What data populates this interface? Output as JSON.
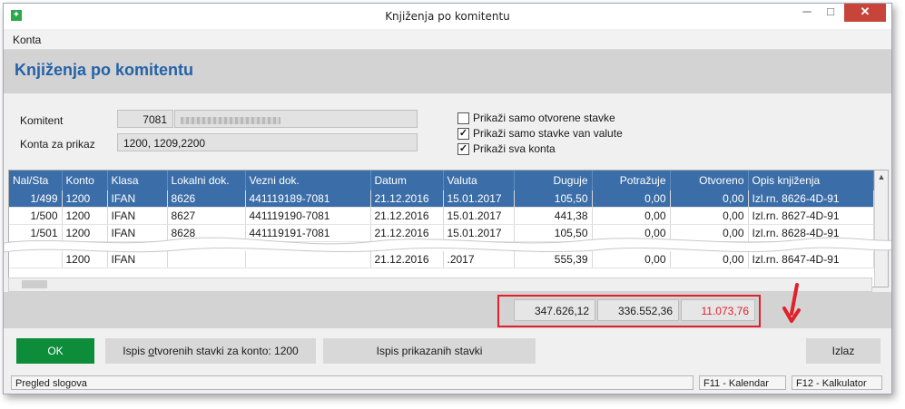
{
  "window": {
    "title": "Knjiženja po komitentu",
    "min_glyph": "─",
    "max_glyph": "□",
    "close_glyph": "✕"
  },
  "menu": {
    "items": [
      "Konta"
    ]
  },
  "header": {
    "title": "Knjiženja po komitentu"
  },
  "filters": {
    "komitent_label": "Komitent",
    "komitent_code": "7081",
    "konta_label": "Konta za prikaz",
    "konta_value": "1200, 1209,2200",
    "checkboxes": [
      {
        "label": "Prikaži samo otvorene stavke",
        "checked": false
      },
      {
        "label": "Prikaži samo stavke van valute",
        "checked": true
      },
      {
        "label": "Prikaži sva konta",
        "checked": true
      }
    ]
  },
  "table": {
    "columns": [
      "Nal/Sta",
      "Konto",
      "Klasa",
      "Lokalni dok.",
      "Vezni dok.",
      "Datum",
      "Valuta",
      "Duguje",
      "Potražuje",
      "Otvoreno",
      "Opis knjiženja"
    ],
    "rows": [
      [
        "1/499",
        "1200",
        "IFAN",
        "8626",
        "441119189-7081",
        "21.12.2016",
        "15.01.2017",
        "105,50",
        "0,00",
        "0,00",
        "Izl.rn. 8626-4D-91"
      ],
      [
        "1/500",
        "1200",
        "IFAN",
        "8627",
        "441119190-7081",
        "21.12.2016",
        "15.01.2017",
        "441,38",
        "0,00",
        "0,00",
        "Izl.rn. 8627-4D-91"
      ],
      [
        "1/501",
        "1200",
        "IFAN",
        "8628",
        "441119191-7081",
        "21.12.2016",
        "15.01.2017",
        "105,50",
        "0,00",
        "0,00",
        "Izl.rn. 8628-4D-91"
      ],
      [
        "",
        "1200",
        "IFAN",
        "",
        "",
        "21.12.2016",
        ".2017",
        "555,39",
        "0,00",
        "0,00",
        "Izl.rn. 8647-4D-91"
      ]
    ]
  },
  "totals": {
    "duguje": "347.626,12",
    "potrazuje": "336.552,36",
    "otvoreno": "11.073,76"
  },
  "buttons": {
    "ok": "OK",
    "ispis_otvorenih_prefix": "Ispis ",
    "ispis_otvorenih_hot": "o",
    "ispis_otvorenih_suffix": "tvorenih stavki za konto: 1200",
    "ispis_prikazanih": "Ispis prikazanih stavki",
    "izlaz": "Izlaz"
  },
  "status": {
    "left": "Pregled slogova",
    "f11": "F11 - Kalendar",
    "f12": "F12 - Kalkulator"
  },
  "colors": {
    "accent": "#3b6ea8",
    "ok": "#0d8c3a",
    "highlight": "#e0202a"
  }
}
